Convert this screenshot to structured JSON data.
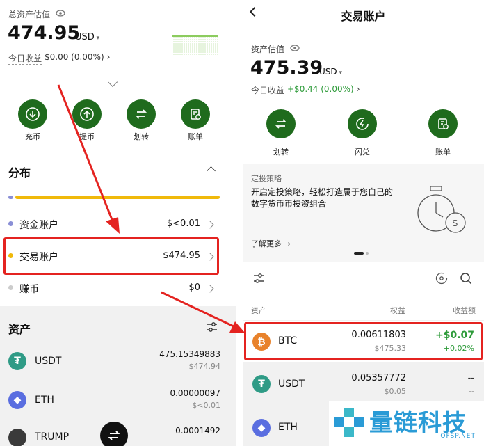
{
  "left": {
    "header": {
      "label": "总资产估值",
      "amount": "474.95",
      "currency": "USD",
      "today_label": "今日收益",
      "today_value": "$0.00 (0.00%)"
    },
    "actions": [
      {
        "label": "充币",
        "icon": "deposit-icon"
      },
      {
        "label": "提币",
        "icon": "withdraw-icon"
      },
      {
        "label": "划转",
        "icon": "transfer-icon"
      },
      {
        "label": "账单",
        "icon": "bill-icon"
      }
    ],
    "distribution": {
      "title": "分布",
      "accounts": [
        {
          "label": "资金账户",
          "value": "$<0.01",
          "color": "#8a8fd6"
        },
        {
          "label": "交易账户",
          "value": "$474.95",
          "color": "#f0b90b"
        },
        {
          "label": "赚币",
          "value": "$0",
          "color": "#cccccc"
        }
      ]
    },
    "assets": {
      "title": "资产",
      "items": [
        {
          "symbol": "USDT",
          "amount": "475.15349883",
          "usd": "$474.94"
        },
        {
          "symbol": "ETH",
          "amount": "0.00000097",
          "usd": "$<0.01"
        },
        {
          "symbol": "TRUMP",
          "amount": "0.0001492",
          "usd": ""
        }
      ]
    }
  },
  "right": {
    "title": "交易账户",
    "header": {
      "label": "资产估值",
      "amount": "475.39",
      "currency": "USD",
      "today_label": "今日收益",
      "today_value": "+$0.44 (0.00%)"
    },
    "actions": [
      {
        "label": "划转",
        "icon": "transfer-icon"
      },
      {
        "label": "闪兑",
        "icon": "flash-swap-icon"
      },
      {
        "label": "账单",
        "icon": "bill-icon"
      }
    ],
    "banner": {
      "tag": "定投策略",
      "text_line1": "开启定投策略，轻松打造属于您自己的",
      "text_line2": "数字货币币投资组合",
      "link": "了解更多"
    },
    "table": {
      "col_asset": "资产",
      "col_equity": "权益",
      "col_pnl": "收益额",
      "rows": [
        {
          "symbol": "BTC",
          "amount": "0.00611803",
          "usd": "$475.33",
          "pnl": "+$0.07",
          "pnl_pct": "+0.02%"
        },
        {
          "symbol": "USDT",
          "amount": "0.05357772",
          "usd": "$0.05",
          "pnl": "--",
          "pnl_pct": "--"
        },
        {
          "symbol": "ETH",
          "amount": "0.00000097",
          "usd": "",
          "pnl": "",
          "pnl_pct": ""
        }
      ]
    }
  },
  "watermark": {
    "text": "量链科技",
    "sub": "QFSP.NET"
  },
  "colors": {
    "accent_green": "#1f6b1d",
    "highlight_red": "#e42320",
    "positive": "#2e9b3a",
    "usdt": "#2f9b86",
    "btc": "#e8822b",
    "eth": "#5a6ee0"
  }
}
